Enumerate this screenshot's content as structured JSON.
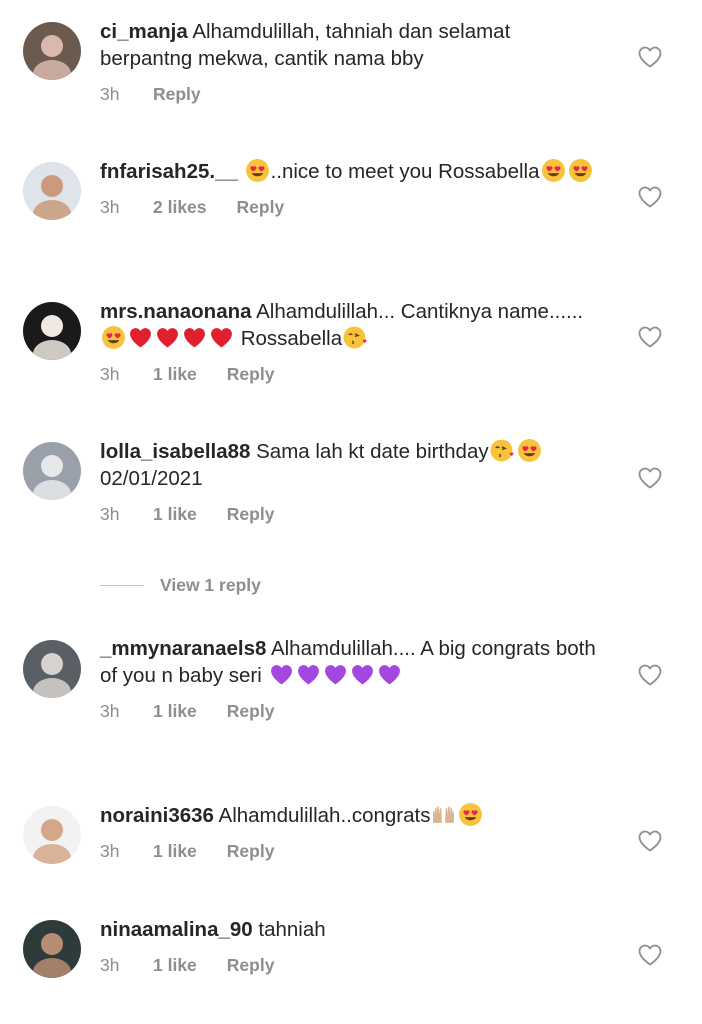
{
  "comments": [
    {
      "username": "ci_manja",
      "segments": [
        {
          "type": "text",
          "value": " Alhamdulillah, tahniah dan selamat berpantng mekwa, cantik nama bby"
        }
      ],
      "time": "3h",
      "likes": "",
      "reply_label": "Reply",
      "avatar": {
        "bg": "#6b5a4e",
        "fg": "#d9b8b0"
      }
    },
    {
      "username": "fnfarisah25.__",
      "segments": [
        {
          "type": "text",
          "value": " "
        },
        {
          "type": "emoji",
          "name": "heart-eyes-emoji"
        },
        {
          "type": "text",
          "value": "..nice to meet you Rossabella"
        },
        {
          "type": "emoji",
          "name": "heart-eyes-emoji"
        },
        {
          "type": "emoji",
          "name": "heart-eyes-emoji"
        }
      ],
      "time": "3h",
      "likes": "2 likes",
      "reply_label": "Reply",
      "avatar": {
        "bg": "#dfe3ea",
        "fg": "#c99a7d"
      }
    },
    {
      "username": "mrs.nanaonana",
      "segments": [
        {
          "type": "text",
          "value": " Alhamdulillah... Cantiknya name...... "
        },
        {
          "type": "emoji",
          "name": "heart-eyes-emoji"
        },
        {
          "type": "emoji",
          "name": "red-heart-emoji"
        },
        {
          "type": "emoji",
          "name": "red-heart-emoji"
        },
        {
          "type": "emoji",
          "name": "red-heart-emoji"
        },
        {
          "type": "emoji",
          "name": "red-heart-emoji"
        },
        {
          "type": "text",
          "value": " Rossabella"
        },
        {
          "type": "emoji",
          "name": "kissing-heart-emoji"
        }
      ],
      "time": "3h",
      "likes": "1 like",
      "reply_label": "Reply",
      "avatar": {
        "bg": "#1a1a1a",
        "fg": "#efe9e1"
      }
    },
    {
      "username": "lolla_isabella88",
      "segments": [
        {
          "type": "text",
          "value": " Sama lah kt date birthday"
        },
        {
          "type": "emoji",
          "name": "kissing-heart-emoji"
        },
        {
          "type": "emoji",
          "name": "heart-eyes-emoji"
        },
        {
          "type": "text",
          "value": "02/01/2021"
        }
      ],
      "time": "3h",
      "likes": "1 like",
      "reply_label": "Reply",
      "avatar": {
        "bg": "#9aa0aa",
        "fg": "#e6e7ea"
      }
    },
    {
      "username": "_mmynaranaels8",
      "segments": [
        {
          "type": "text",
          "value": " Alhamdulillah.... A big congrats both of you n baby seri "
        },
        {
          "type": "emoji",
          "name": "purple-heart-emoji"
        },
        {
          "type": "emoji",
          "name": "purple-heart-emoji"
        },
        {
          "type": "emoji",
          "name": "purple-heart-emoji"
        },
        {
          "type": "emoji",
          "name": "purple-heart-emoji"
        },
        {
          "type": "emoji",
          "name": "purple-heart-emoji"
        }
      ],
      "time": "3h",
      "likes": "1 like",
      "reply_label": "Reply",
      "avatar": {
        "bg": "#5a5f66",
        "fg": "#d7d2cf"
      }
    },
    {
      "username": "noraini3636",
      "segments": [
        {
          "type": "text",
          "value": " Alhamdulillah..congrats"
        },
        {
          "type": "emoji",
          "name": "raising-hands-emoji"
        },
        {
          "type": "emoji",
          "name": "heart-eyes-emoji"
        }
      ],
      "time": "3h",
      "likes": "1 like",
      "reply_label": "Reply",
      "avatar": {
        "bg": "#f2f2f2",
        "fg": "#d4a78a"
      }
    },
    {
      "username": "ninaamalina_90",
      "segments": [
        {
          "type": "text",
          "value": " tahniah"
        }
      ],
      "time": "3h",
      "likes": "1 like",
      "reply_label": "Reply",
      "avatar": {
        "bg": "#2d3b3a",
        "fg": "#b88c73"
      }
    }
  ],
  "view_replies_label": "View 1 reply",
  "colors": {
    "text": "#262626",
    "secondary": "#8e8e8e",
    "heart_outline": "#8e8e8e"
  },
  "icons": {
    "like": "heart-outline-icon"
  }
}
